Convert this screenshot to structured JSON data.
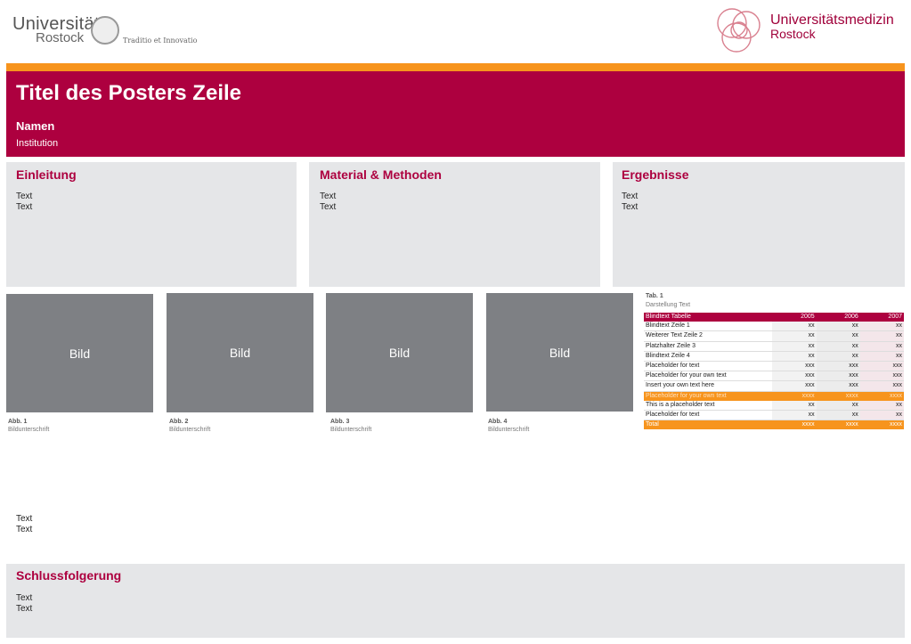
{
  "logos": {
    "uni_word1": "Universität",
    "uni_word2": "Rostock",
    "uni_motto": "Traditio et Innovatio",
    "um_title": "Universitätsmedizin",
    "um_sub": "Rostock"
  },
  "colors": {
    "brand": "#ad003f",
    "accent": "#f7941d",
    "panel": "#e5e6e8",
    "image": "#7e8084"
  },
  "header": {
    "title": "Titel des Posters Zeile",
    "names": "Namen",
    "institution": "Institution"
  },
  "sections": [
    {
      "heading": "Einleitung",
      "line1": "Text",
      "line2": "Text"
    },
    {
      "heading": "Material & Methoden",
      "line1": "Text",
      "line2": "Text"
    },
    {
      "heading": "Ergebnisse",
      "line1": "Text",
      "line2": "Text"
    }
  ],
  "figures": [
    {
      "label": "Bild",
      "caption_num": "Abb. 1",
      "caption": "Bildunterschrift"
    },
    {
      "label": "Bild",
      "caption_num": "Abb. 2",
      "caption": "Bildunterschrift"
    },
    {
      "label": "Bild",
      "caption_num": "Abb. 3",
      "caption": "Bildunterschrift"
    },
    {
      "label": "Bild",
      "caption_num": "Abb. 4",
      "caption": "Bildunterschrift"
    }
  ],
  "table": {
    "caption_num": "Tab. 1",
    "caption": "Darstellung Text",
    "header": [
      "Blindtext Tabelle",
      "2005",
      "2006",
      "2007"
    ],
    "rows": [
      [
        "Blindtext Zeile 1",
        "xx",
        "xx",
        "xx"
      ],
      [
        "Weiterer Text Zeile 2",
        "xx",
        "xx",
        "xx"
      ],
      [
        "Platzhalter Zeile 3",
        "xx",
        "xx",
        "xx"
      ],
      [
        "Blindtext Zeile 4",
        "xx",
        "xx",
        "xx"
      ],
      [
        "Placeholder for text",
        "xxx",
        "xxx",
        "xxx"
      ],
      [
        "Placeholder for your own text",
        "xxx",
        "xxx",
        "xxx"
      ],
      [
        "Insert your own text here",
        "xxx",
        "xxx",
        "xxx"
      ],
      [
        "Placeholder for your own text",
        "xxxx",
        "xxxx",
        "xxxx"
      ],
      [
        "This is a placeholder text",
        "xx",
        "xx",
        "xx"
      ],
      [
        "Placeholder for  text",
        "xx",
        "xx",
        "xx"
      ]
    ],
    "total": [
      "Total",
      "xxxx",
      "xxxx",
      "xxxx"
    ]
  },
  "free_text": {
    "line1": "Text",
    "line2": "Text"
  },
  "conclusion": {
    "heading": "Schlussfolgerung",
    "line1": "Text",
    "line2": "Text"
  }
}
